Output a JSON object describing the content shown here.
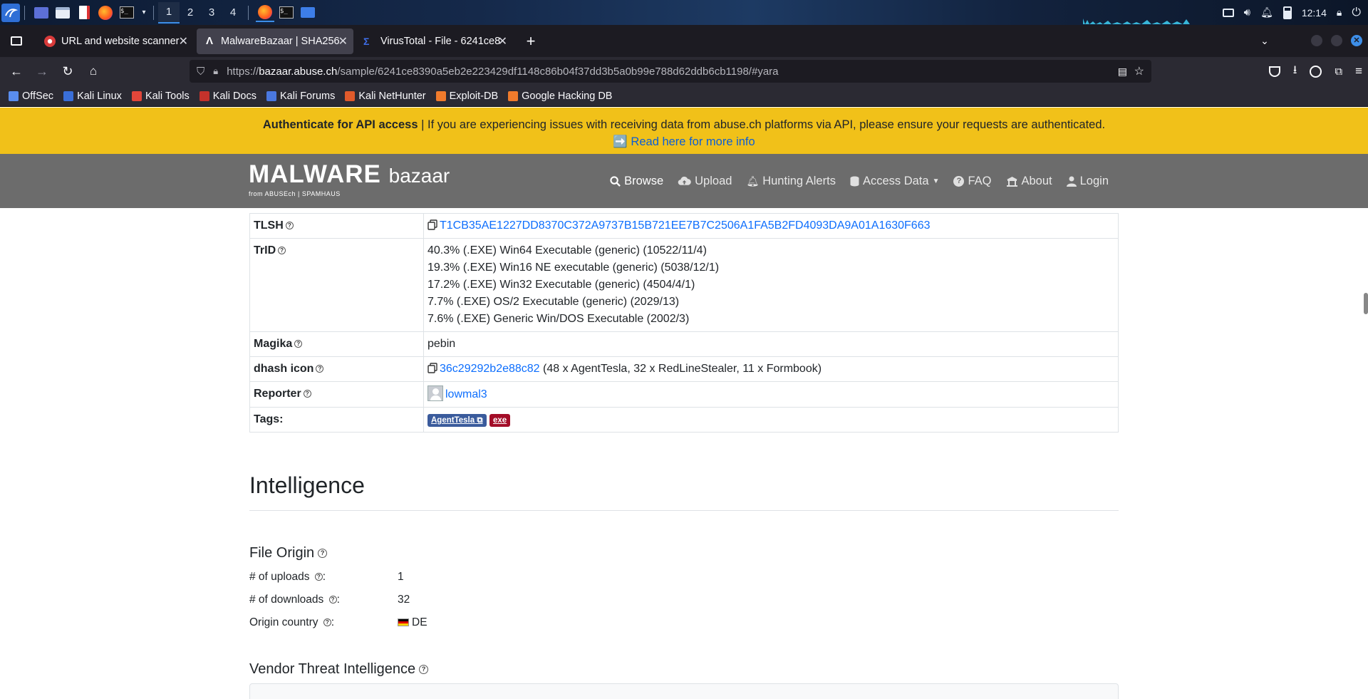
{
  "taskbar": {
    "workspaces": [
      "1",
      "2",
      "3",
      "4"
    ],
    "clock": "12:14"
  },
  "tabs": [
    {
      "label": "URL and website scanner"
    },
    {
      "label": "MalwareBazaar | SHA256"
    },
    {
      "label": "VirusTotal - File - 6241ce8"
    }
  ],
  "navbar": {
    "url_prefix": "https://",
    "url_host": "bazaar.abuse.ch",
    "url_path": "/sample/6241ce8390a5eb2e223429df1148c86b04f37dd3b5a0b99e788d62ddb6cb1198/#yara"
  },
  "bookmarks": [
    {
      "label": "OffSec",
      "color": "#5a8dee"
    },
    {
      "label": "Kali Linux",
      "color": "#3a6fd9"
    },
    {
      "label": "Kali Tools",
      "color": "#e2463a"
    },
    {
      "label": "Kali Docs",
      "color": "#c4322b"
    },
    {
      "label": "Kali Forums",
      "color": "#4a78e0"
    },
    {
      "label": "Kali NetHunter",
      "color": "#e05a2b"
    },
    {
      "label": "Exploit-DB",
      "color": "#f07b2c"
    },
    {
      "label": "Google Hacking DB",
      "color": "#f07b2c"
    }
  ],
  "announcement": {
    "bold": "Authenticate for API access",
    "text": " | If you are experiencing issues with receiving data from abuse.ch platforms via API, please ensure your requests are authenticated.",
    "link": "➡️ Read here for more info"
  },
  "site": {
    "logo_main": "MALWARE",
    "logo_sub": "bazaar",
    "logo_from": "from ABUSEch | SPAMHAUS",
    "menu": [
      {
        "label": "Browse",
        "icon": "search-icon",
        "active": true
      },
      {
        "label": "Upload",
        "icon": "cloud-upload-icon"
      },
      {
        "label": "Hunting Alerts",
        "icon": "bell-icon"
      },
      {
        "label": "Access Data",
        "icon": "database-icon",
        "dropdown": true
      },
      {
        "label": "FAQ",
        "icon": "question-icon"
      },
      {
        "label": "About",
        "icon": "building-icon"
      },
      {
        "label": "Login",
        "icon": "user-icon"
      }
    ]
  },
  "info_table": {
    "tlsh_key": "TLSH",
    "tlsh_value": "T1CB35AE1227DD8370C372A9737B15B721EE7B7C2506A1FA5B2FD4093DA9A01A1630F663",
    "trid_key": "TrID",
    "trid_values": [
      "40.3% (.EXE) Win64 Executable (generic) (10522/11/4)",
      "19.3% (.EXE) Win16 NE executable (generic) (5038/12/1)",
      "17.2% (.EXE) Win32 Executable (generic) (4504/4/1)",
      "7.7% (.EXE) OS/2 Executable (generic) (2029/13)",
      "7.6% (.EXE) Generic Win/DOS Executable (2002/3)"
    ],
    "magika_key": "Magika",
    "magika_value": "pebin",
    "dhash_key": "dhash icon",
    "dhash_link": "36c29292b2e88c82",
    "dhash_extra": " (48 x AgentTesla, 32 x RedLineStealer, 11 x Formbook)",
    "reporter_key": "Reporter",
    "reporter_value": "lowmal3",
    "tags_key": "Tags:",
    "tags": [
      "AgentTesla",
      "exe"
    ]
  },
  "intelligence": {
    "title": "Intelligence",
    "file_origin_title": "File Origin",
    "uploads_label": "# of uploads",
    "uploads_value": "1",
    "downloads_label": "# of downloads",
    "downloads_value": "32",
    "country_label": "Origin country",
    "country_value": "DE",
    "vendor_title": "Vendor Threat Intelligence"
  },
  "colors": {
    "announce_bg": "#f1c119",
    "nav_bg": "#6c6c6c",
    "link": "#0d6efd",
    "tag_blue": "#3a5b9c",
    "tag_red": "#a30d28"
  }
}
